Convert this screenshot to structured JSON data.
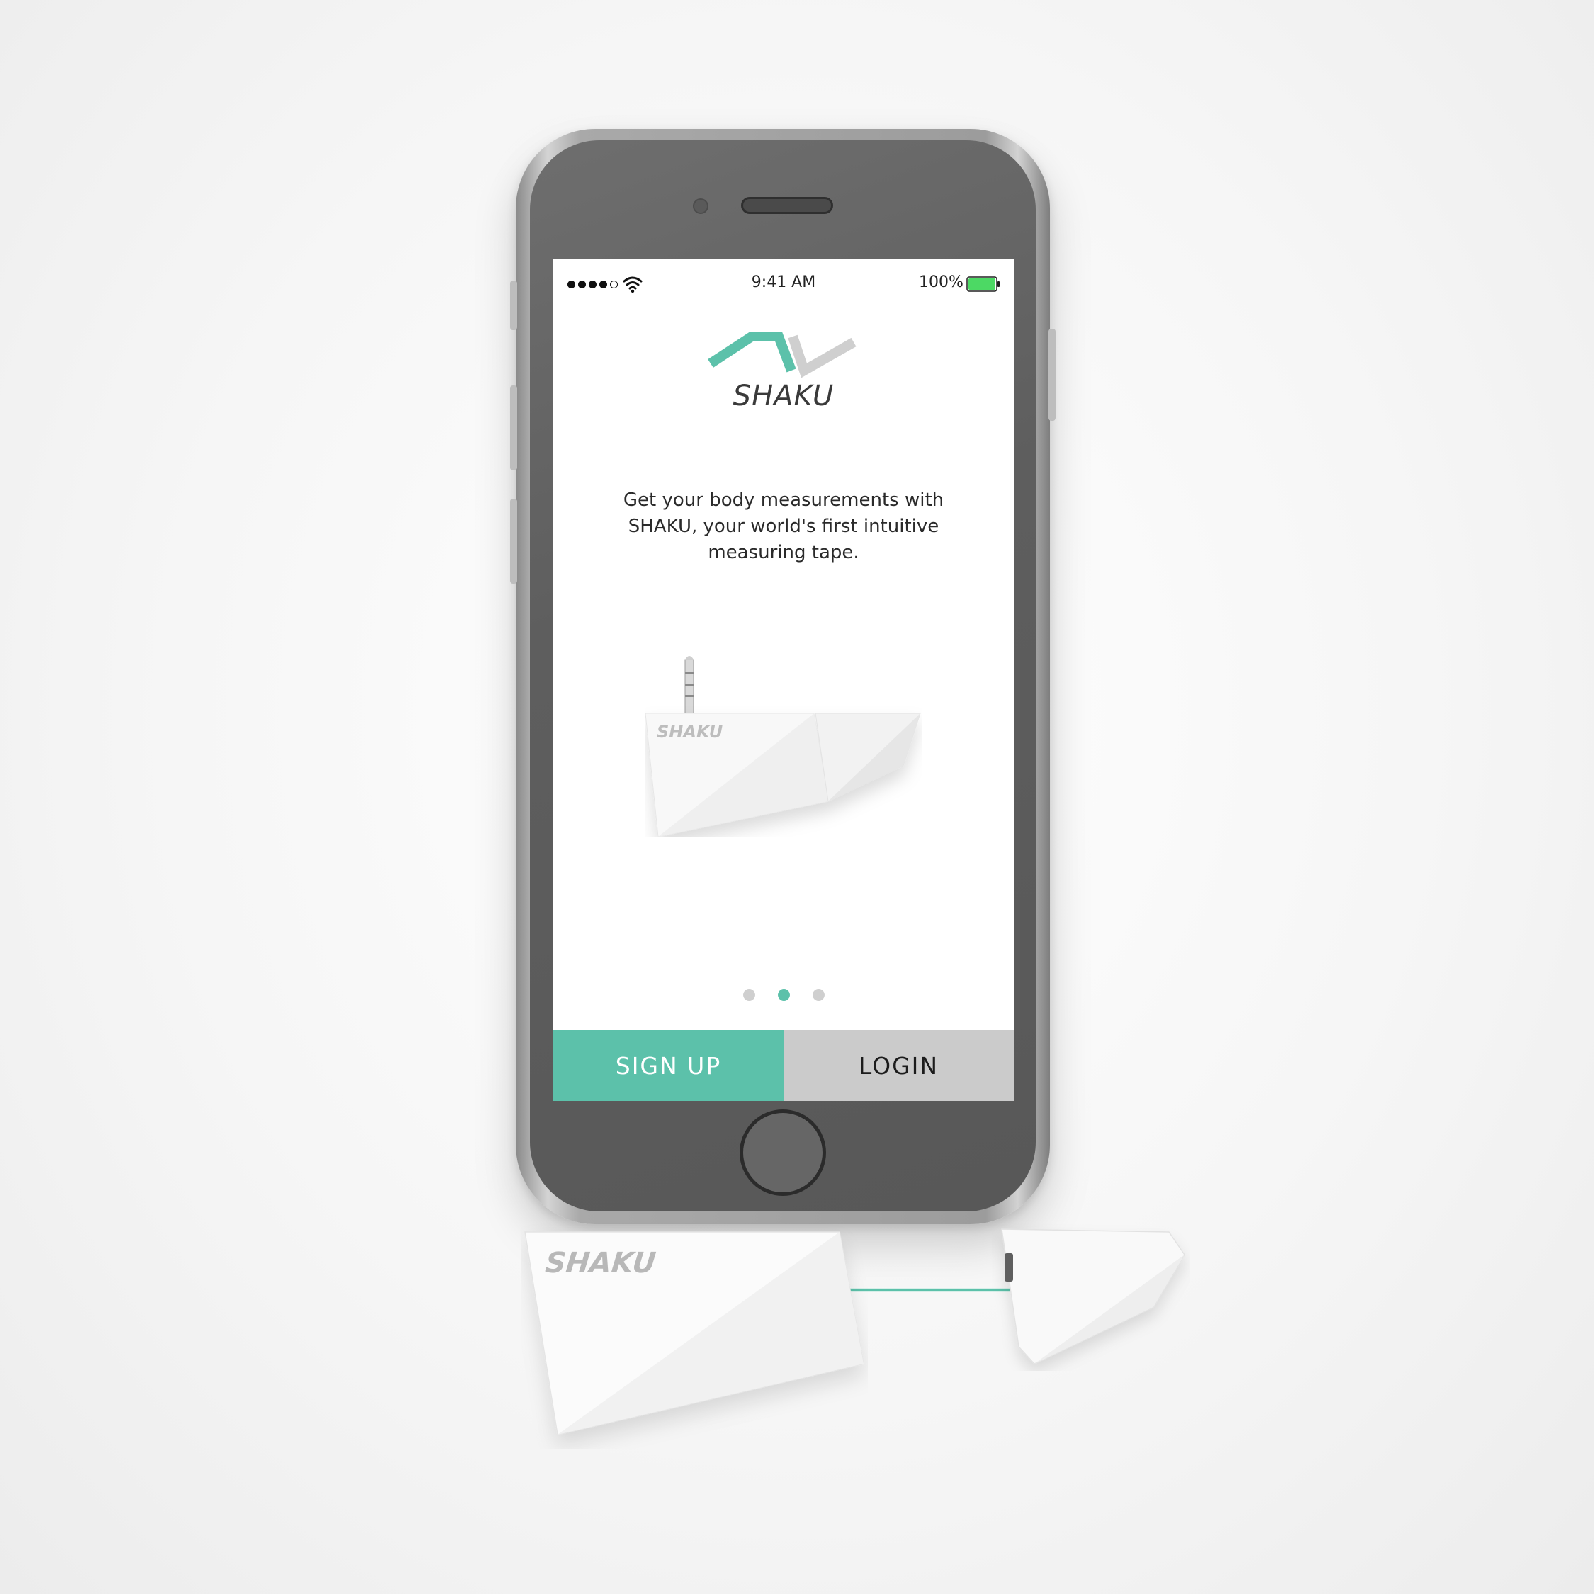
{
  "status_bar": {
    "time": "9:41 AM",
    "battery_percent": "100%",
    "signal_bars_filled": 4,
    "signal_bars_total": 5,
    "icons": [
      "signal-dots-icon",
      "wifi-icon",
      "battery-icon"
    ]
  },
  "app": {
    "logo_text": "SHAKU",
    "intro_text": "Get your body measurements with SHAKU, your world's first intuitive measuring tape.",
    "device_label": "SHAKU"
  },
  "pager": {
    "count": 3,
    "active_index": 1
  },
  "actions": {
    "signup_label": "SIGN UP",
    "login_label": "LOGIN"
  },
  "product": {
    "brand": "SHAKU"
  },
  "colors": {
    "accent": "#5cc1aa",
    "secondary_button": "#cbcbcb",
    "battery": "#4cd964"
  }
}
